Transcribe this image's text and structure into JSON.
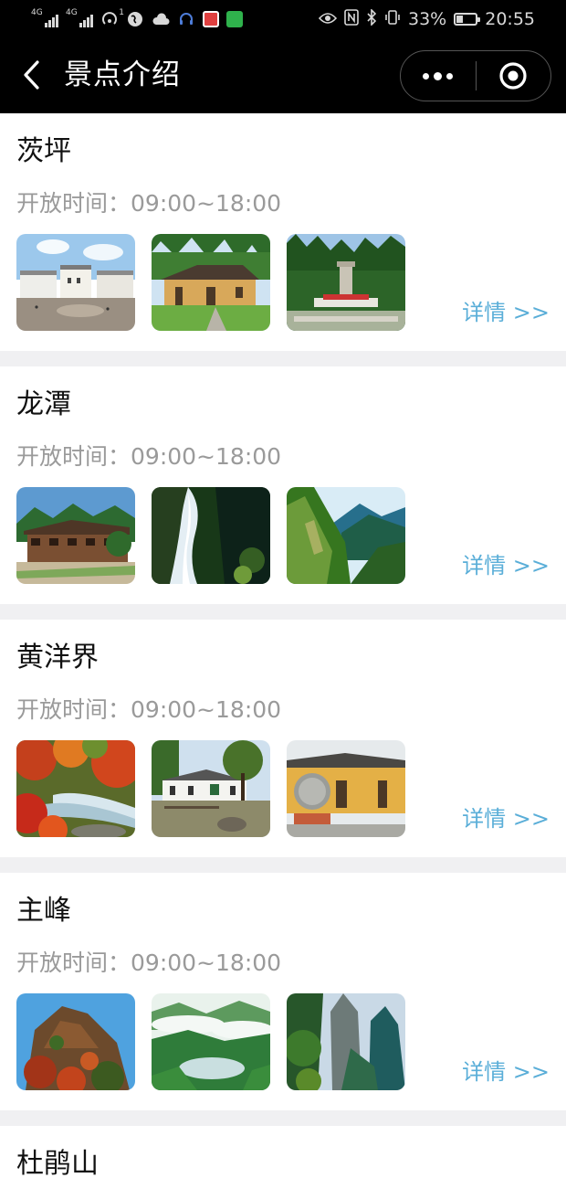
{
  "status_bar": {
    "sim1": "4G",
    "sim2": "4G",
    "hotspot_count": "1",
    "battery": "33%",
    "time": "20:55"
  },
  "nav": {
    "title": "景点介绍"
  },
  "labels": {
    "open_prefix": "开放时间：",
    "detail": "详情 >>"
  },
  "spots": [
    {
      "name": "茨坪",
      "open_time": "09:00~18:00"
    },
    {
      "name": "龙潭",
      "open_time": "09:00~18:00"
    },
    {
      "name": "黄洋界",
      "open_time": "09:00~18:00"
    },
    {
      "name": "主峰",
      "open_time": "09:00~18:00"
    },
    {
      "name": "杜鹃山"
    }
  ],
  "colors": {
    "accent": "#5aaed8",
    "header_bg": "#000000",
    "divider": "#f0f0f2",
    "muted_text": "#9a9a9a"
  },
  "icons": {
    "back": "chevron-left-icon",
    "more": "more-dots-icon",
    "close": "target-circle-icon"
  }
}
